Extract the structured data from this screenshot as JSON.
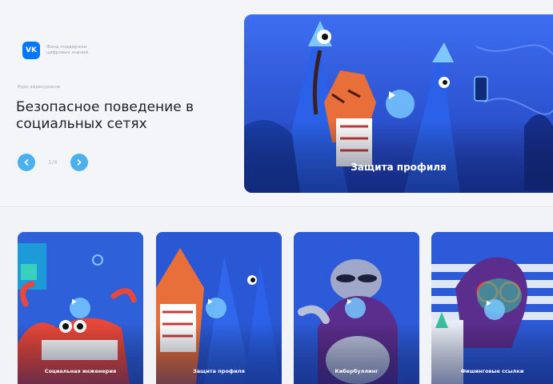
{
  "brand": {
    "logo_text": "VK",
    "name": "Фонд поддержки\nцифровых знаний"
  },
  "course_label": "Курс видеоуроков",
  "page_title": "Безопасное поведение в социальных сетях",
  "slider": {
    "counter": "1/4"
  },
  "hero": {
    "caption": "Защита профиля"
  },
  "cards": [
    {
      "caption": "Социальная инженерия"
    },
    {
      "caption": "Защита профиля"
    },
    {
      "caption": "Кибербуллинг"
    },
    {
      "caption": "Фишинговые ссылки"
    }
  ],
  "colors": {
    "accent": "#0077ff",
    "button": "#4bb0f0",
    "card_blue": "#2f62dc"
  }
}
